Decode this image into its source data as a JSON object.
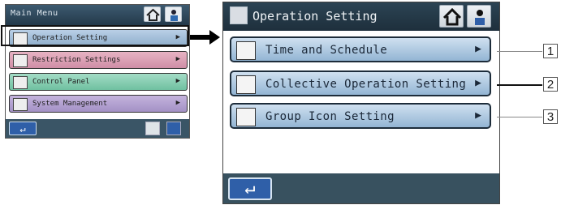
{
  "main_menu": {
    "title": "Main Menu",
    "items": [
      {
        "label": "Operation Setting",
        "arrow": "▶",
        "color": "#9fbcd9"
      },
      {
        "label": "Restriction Settings",
        "arrow": "▶",
        "color": "#dfa2b7"
      },
      {
        "label": "Control Panel",
        "arrow": "▶",
        "color": "#86ceb1"
      },
      {
        "label": "System Management",
        "arrow": "▶",
        "color": "#b3a2d1"
      }
    ],
    "return_symbol": "↵"
  },
  "operation_setting": {
    "title": "Operation Setting",
    "items": [
      {
        "label": "Time and Schedule",
        "arrow": "▶"
      },
      {
        "label": "Collective Operation Setting",
        "arrow": "▶"
      },
      {
        "label": "Group Icon Setting",
        "arrow": "▶"
      }
    ],
    "return_symbol": "↵"
  },
  "callouts": [
    "1",
    "2",
    "3"
  ]
}
